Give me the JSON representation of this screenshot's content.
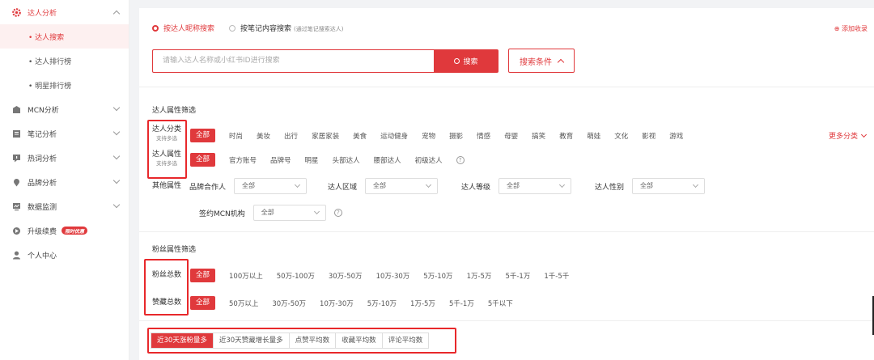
{
  "sidebar": {
    "groups": [
      {
        "label": "达人分析",
        "icon": "gear-icon"
      },
      {
        "label": "MCN分析",
        "icon": "building-icon"
      },
      {
        "label": "笔记分析",
        "icon": "document-icon"
      },
      {
        "label": "热词分析",
        "icon": "message-icon"
      },
      {
        "label": "品牌分析",
        "icon": "badge-icon"
      },
      {
        "label": "数据监测",
        "icon": "monitor-icon"
      },
      {
        "label": "升级续费",
        "icon": "rocket-icon",
        "badge": "限时优惠"
      },
      {
        "label": "个人中心",
        "icon": "user-icon"
      }
    ],
    "sub_items": [
      {
        "label": "• 达人搜索"
      },
      {
        "label": "• 达人排行榜"
      },
      {
        "label": "• 明星排行榜"
      }
    ]
  },
  "search": {
    "mode_nickname": "按达人昵称搜索",
    "mode_note": "按笔记内容搜索",
    "mode_note_hint": "(通过笔记搜索达人)",
    "add_fav": "⊕ 添加收录",
    "placeholder": "请输入达人名称或小红书ID进行搜索",
    "button": "搜索",
    "conditions": "搜索条件"
  },
  "influencer_filter": {
    "title": "达人属性筛选",
    "category_label": "达人分类",
    "category_hint": "支持多选",
    "categories": [
      "全部",
      "时尚",
      "美妆",
      "出行",
      "家居家装",
      "美食",
      "运动健身",
      "宠物",
      "摄影",
      "情感",
      "母婴",
      "搞笑",
      "教育",
      "萌娃",
      "文化",
      "影视",
      "游戏"
    ],
    "more": "更多分类",
    "attr_label": "达人属性",
    "attr_hint": "支持多选",
    "attrs": [
      "全部",
      "官方账号",
      "品牌号",
      "明星",
      "头部达人",
      "腰部达人",
      "初级达人"
    ],
    "help": "?",
    "other_label": "其他属性",
    "fields": [
      {
        "label": "品牌合作人",
        "value": "全部"
      },
      {
        "label": "达人区域",
        "value": "全部"
      },
      {
        "label": "达人等级",
        "value": "全部"
      },
      {
        "label": "达人性别",
        "value": "全部"
      }
    ],
    "mcn": {
      "label": "签约MCN机构",
      "value": "全部"
    }
  },
  "fans_filter": {
    "title": "粉丝属性筛选",
    "fans_label": "粉丝总数",
    "fans_options": [
      "全部",
      "100万以上",
      "50万-100万",
      "30万-50万",
      "10万-30万",
      "5万-10万",
      "1万-5万",
      "5千-1万",
      "1千-5千"
    ],
    "likes_label": "赞藏总数",
    "likes_options": [
      "全部",
      "50万以上",
      "30万-50万",
      "10万-30万",
      "5万-10万",
      "1万-5万",
      "5千-1万",
      "5千以下"
    ]
  },
  "sort": {
    "options": [
      "近30天涨粉量多",
      "近30天赞藏增长量多",
      "点赞平均数",
      "收藏平均数",
      "评论平均数"
    ]
  },
  "colors": {
    "accent": "#e0393c",
    "highlight_box": "#e8282b"
  }
}
